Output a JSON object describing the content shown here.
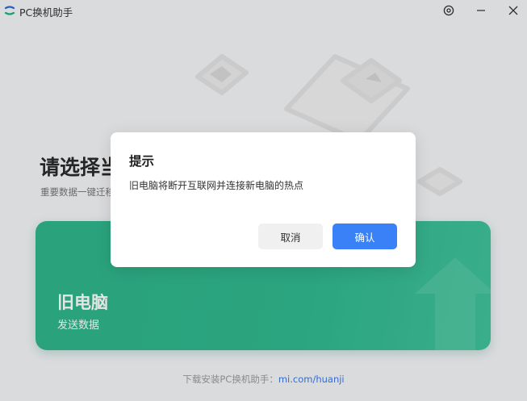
{
  "window": {
    "title": "PC换机助手",
    "icons": {
      "logo": "app-logo-icon",
      "settings": "settings-icon",
      "minimize": "minimize-icon",
      "close": "close-icon"
    }
  },
  "main": {
    "heading": "请选择当",
    "subheading": "重要数据一键迁移",
    "old_pc_card": {
      "title": "旧电脑",
      "subtitle": "发送数据",
      "color": "#30b88e"
    }
  },
  "footer": {
    "prefix": "下载安装PC换机助手：",
    "link": "mi.com/huanji",
    "link_color": "#3a78ee"
  },
  "dialog": {
    "title": "提示",
    "message": "旧电脑将断开互联网并连接新电脑的热点",
    "cancel_label": "取消",
    "confirm_label": "确认",
    "confirm_color": "#3a80f7"
  }
}
